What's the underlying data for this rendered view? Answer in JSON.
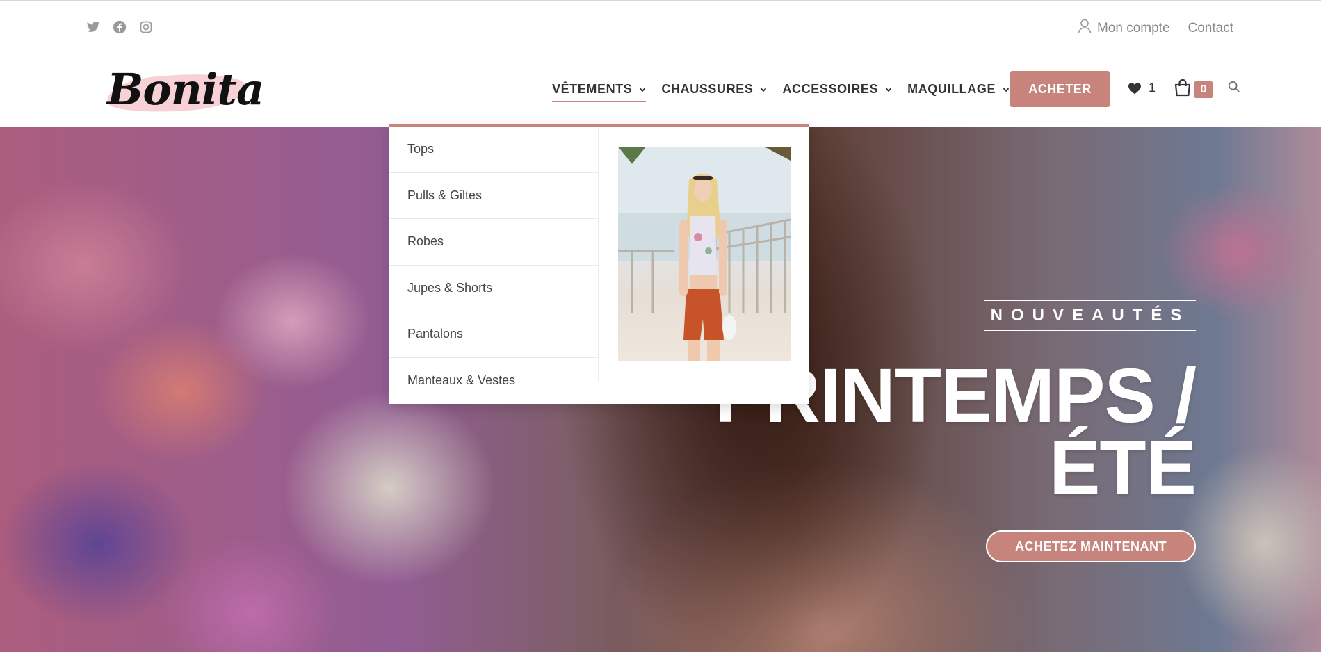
{
  "topbar": {
    "social": [
      {
        "icon": "twitter-icon"
      },
      {
        "icon": "facebook-icon"
      },
      {
        "icon": "instagram-icon"
      }
    ],
    "account_label": "Mon compte",
    "contact_label": "Contact"
  },
  "header": {
    "logo_text": "Bonita",
    "nav": [
      {
        "label": "VÊTEMENTS"
      },
      {
        "label": "CHAUSSURES"
      },
      {
        "label": "ACCESSOIRES"
      },
      {
        "label": "MAQUILLAGE"
      }
    ],
    "buy_label": "ACHETER",
    "wishlist_count": "1",
    "cart_count": "0"
  },
  "megamenu": {
    "items": [
      {
        "label": "Tops"
      },
      {
        "label": "Pulls & Giltes"
      },
      {
        "label": "Robes"
      },
      {
        "label": "Jupes & Shorts"
      },
      {
        "label": "Pantalons"
      },
      {
        "label": "Manteaux & Vestes"
      }
    ]
  },
  "hero": {
    "tagline": "NOUVEAUTÉS",
    "headline_line1": "PRINTEMPS /",
    "headline_line2": "ÉTÉ",
    "cta_label": "ACHETEZ MAINTENANT"
  },
  "colors": {
    "accent": "#c6847d",
    "nav_text": "#333333",
    "muted_text": "#888888"
  }
}
